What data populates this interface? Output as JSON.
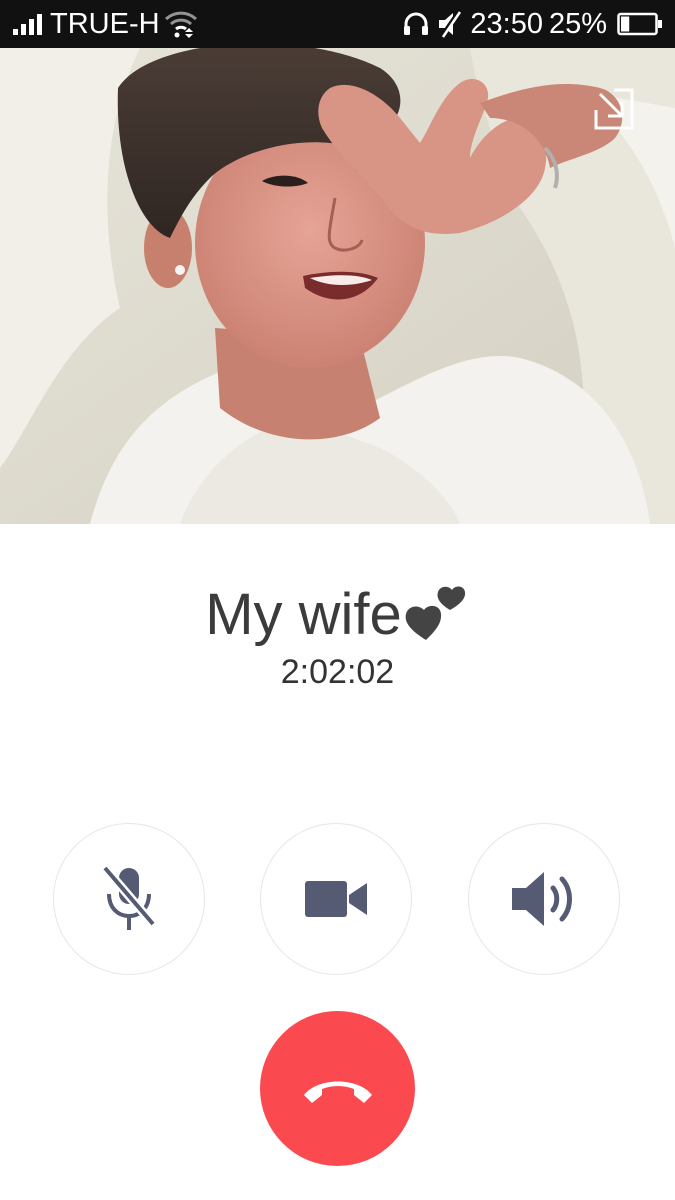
{
  "status_bar": {
    "carrier": "TRUE-H",
    "time": "23:50",
    "battery_percent": "25%",
    "battery_level": 0.25,
    "icons": [
      "signal-icon",
      "wifi-icon",
      "headphones-icon",
      "mute-icon",
      "battery-icon"
    ]
  },
  "call": {
    "contact_name": "My wife",
    "duration": "2:02:02",
    "state": "in-call"
  },
  "controls": {
    "mute": {
      "icon": "mic-off-icon"
    },
    "video": {
      "icon": "video-camera-icon"
    },
    "speaker": {
      "icon": "speaker-icon"
    },
    "end_call": {
      "icon": "hang-up-icon",
      "color": "#fb4a4f"
    }
  },
  "colors": {
    "icon": "#545b72",
    "end_call": "#fb4a4f",
    "text": "#3b3b3b"
  }
}
